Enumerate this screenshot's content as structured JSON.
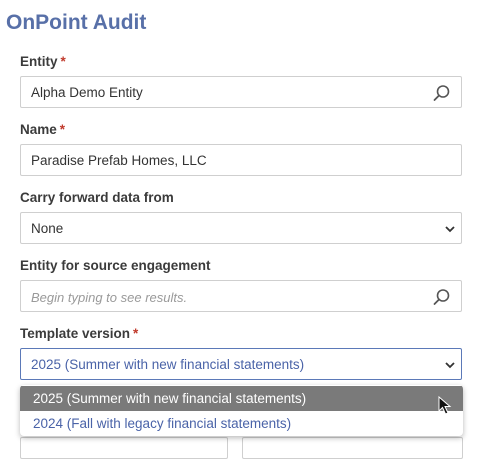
{
  "app": {
    "title": "OnPoint Audit"
  },
  "form": {
    "entity": {
      "label": "Entity",
      "required_mark": "*",
      "value": "Alpha Demo Entity",
      "icon": "search-icon"
    },
    "name": {
      "label": "Name",
      "required_mark": "*",
      "value": "Paradise Prefab Homes, LLC"
    },
    "carry_forward": {
      "label": "Carry forward data from",
      "value": "None",
      "icon": "chevron-down-icon"
    },
    "source_entity": {
      "label": "Entity for source engagement",
      "placeholder": "Begin typing to see results.",
      "icon": "search-icon"
    },
    "template_version": {
      "label": "Template version",
      "required_mark": "*",
      "value": "2025 (Summer with new financial statements)",
      "icon": "chevron-down-icon",
      "options": [
        "2025 (Summer with new financial statements)",
        "2024 (Fall with legacy financial statements)"
      ],
      "hovered_option_index": 0
    }
  },
  "colors": {
    "title": "#5870a8",
    "required": "#c0392b",
    "focus_border": "#5b79b8",
    "option_hover_bg": "#7a7a7a"
  }
}
